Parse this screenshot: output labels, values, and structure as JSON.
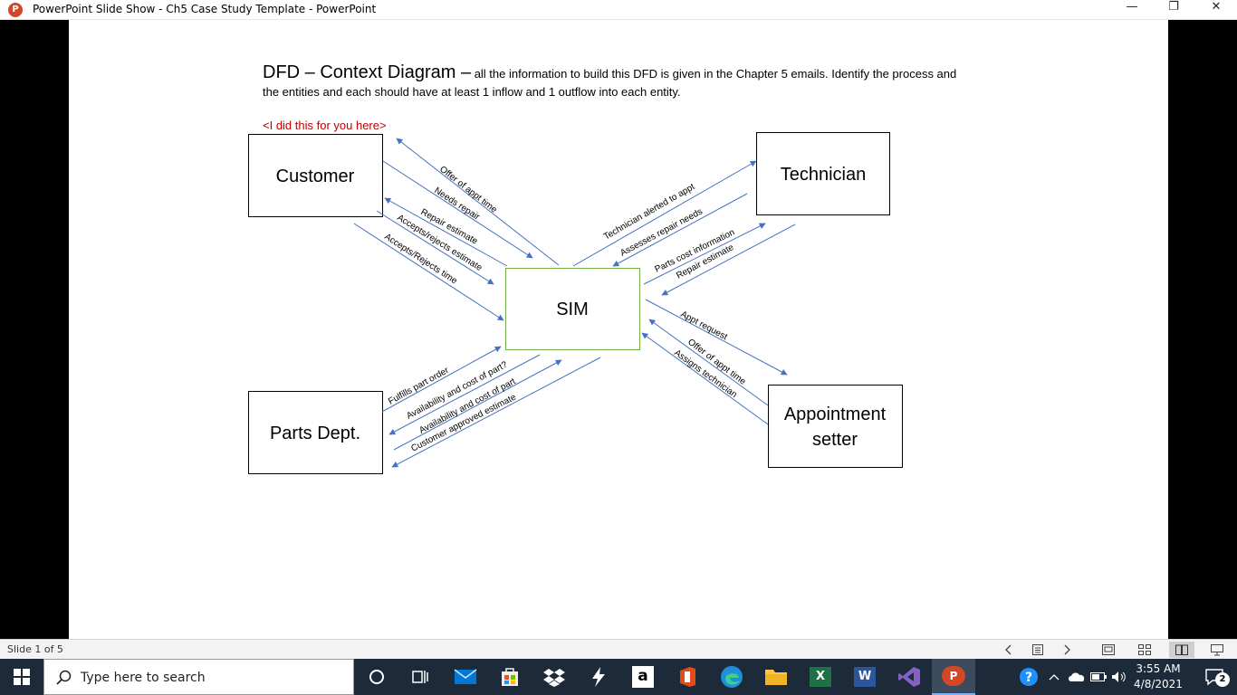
{
  "window": {
    "app_icon_letter": "P",
    "title": "PowerPoint Slide Show  -  Ch5 Case Study Template - PowerPoint",
    "minimize": "—",
    "restore": "❐",
    "close": "✕"
  },
  "slide": {
    "heading_large": "DFD – Context Diagram –",
    "heading_small": " all the information to build this DFD is given in the Chapter 5 emails.  Identify the process and",
    "heading_line2": "the entities and each should have at least 1 inflow and 1 outflow into each entity.",
    "note": "<I did this for you here>",
    "note_color": "#c00000",
    "line_color": "#4472c4",
    "process_border_color": "#70ad47",
    "entities": {
      "customer": "Customer",
      "technician": "Technician",
      "parts": "Parts Dept.",
      "appointment_line1": "Appointment",
      "appointment_line2": "setter"
    },
    "process": "SIM",
    "flows": {
      "offer_appt_time": "Offer of appt time",
      "needs_repair": "Needs repair",
      "repair_estimate": "Repair estimate",
      "accepts_rejects_estimate": "Accepts/rejects estimate",
      "accepts_rejects_time": "Accepts/Rejects time",
      "technician_alerted": "Technician alerted to appt",
      "assesses_repair": "Assesses repair needs",
      "parts_cost_info": "Parts cost information",
      "tech_repair_estimate": "Repair estimate",
      "appt_request": "Appt request",
      "setter_offer_appt_time": "Offer of appt time",
      "assigns_technician": "Assigns technician",
      "fulfills_part_order": "Fulfills part order",
      "availability_cost_q": "Availability and cost of part?",
      "availability_cost": "Availability and cost of part",
      "customer_approved": "Customer approved estimate"
    }
  },
  "statusbar": {
    "slide_count": "Slide 1 of 5"
  },
  "taskbar": {
    "search_placeholder": "Type here to search",
    "amazon_letter": "a",
    "excel_letter": "X",
    "word_letter": "W",
    "ppt_letter": "P",
    "time": "3:55 AM",
    "date": "4/8/2021",
    "notifications_count": "2"
  }
}
